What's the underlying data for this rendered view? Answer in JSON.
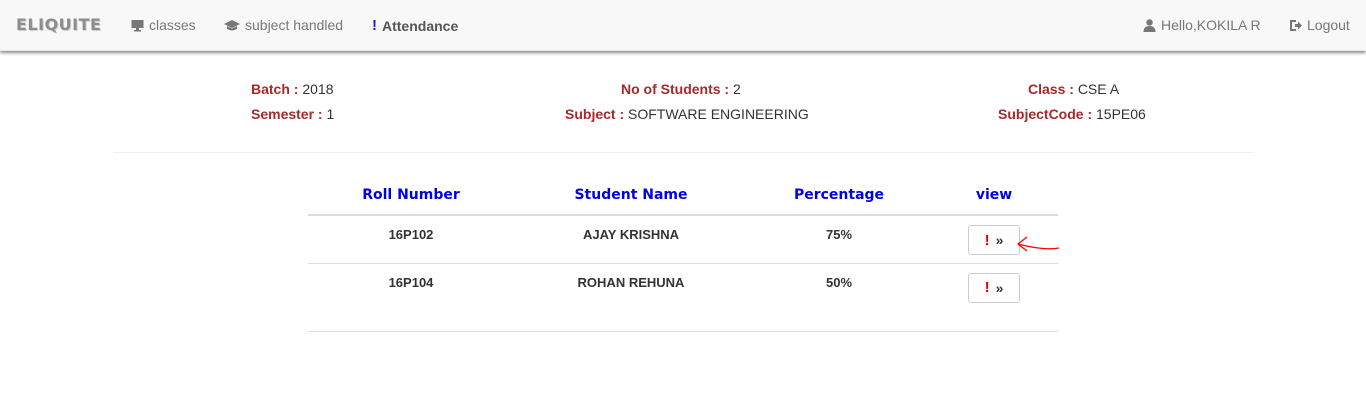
{
  "navbar": {
    "brand": "ELIQUITE",
    "items": [
      {
        "label": "classes",
        "icon": "monitor-icon"
      },
      {
        "label": "subject handled",
        "icon": "graduation-cap-icon"
      },
      {
        "label": "Attendance",
        "icon": "exclamation-icon"
      }
    ],
    "user_greeting": "Hello,KOKILA R",
    "logout_label": "Logout"
  },
  "info": {
    "batch_label": "Batch :",
    "batch_value": "2018",
    "semester_label": "Semester :",
    "semester_value": "1",
    "students_label": "No of Students :",
    "students_value": "2",
    "subject_label": "Subject :",
    "subject_value": "SOFTWARE ENGINEERING",
    "class_label": "Class :",
    "class_value": "CSE A",
    "subjectcode_label": "SubjectCode :",
    "subjectcode_value": "15PE06"
  },
  "table": {
    "headers": [
      "Roll Number",
      "Student Name",
      "Percentage",
      "view"
    ],
    "rows": [
      {
        "roll": "16P102",
        "name": "AJAY KRISHNA",
        "percentage": "75%"
      },
      {
        "roll": "16P104",
        "name": "ROHAN REHUNA",
        "percentage": "50%"
      }
    ],
    "view_button": {
      "icon": "!",
      "chevron": "»"
    }
  },
  "colors": {
    "label_red": "#a52a2a",
    "header_blue": "#0000e6",
    "button_exclamation": "#e00000",
    "annotation_arrow": "#ff0000"
  }
}
